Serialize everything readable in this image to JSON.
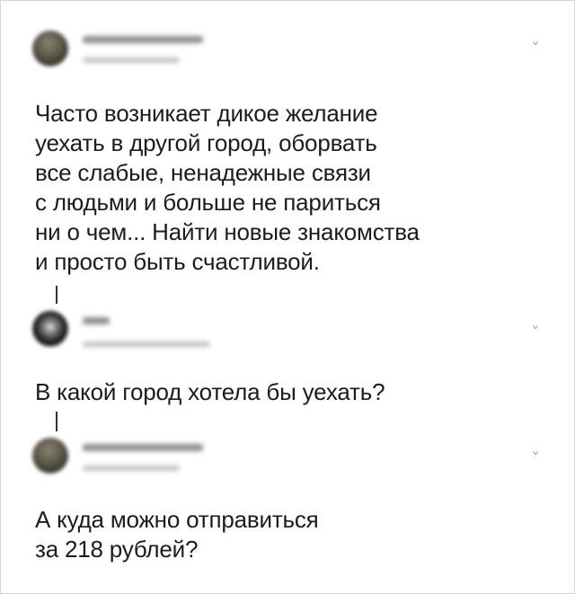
{
  "tweets": [
    {
      "text": "Часто возникает дикое желание\nуехать в другой город, оборвать\nвсе слабые, ненадежные связи\nс людьми и больше не париться\nни о чем... Найти новые знакомства\nи просто быть счастливой.",
      "avatar": "blurred-profile-photo",
      "chevron": "˅"
    },
    {
      "text": "В какой город хотела бы уехать?",
      "avatar": "blurred-profile-photo",
      "chevron": "˅"
    },
    {
      "text": "А куда можно отправиться\nза 218 рублей?",
      "avatar": "blurred-profile-photo",
      "chevron": "˅"
    }
  ],
  "colors": {
    "text": "#1c1c1c",
    "thread": "#333333",
    "chevron": "#a8a8a8"
  }
}
